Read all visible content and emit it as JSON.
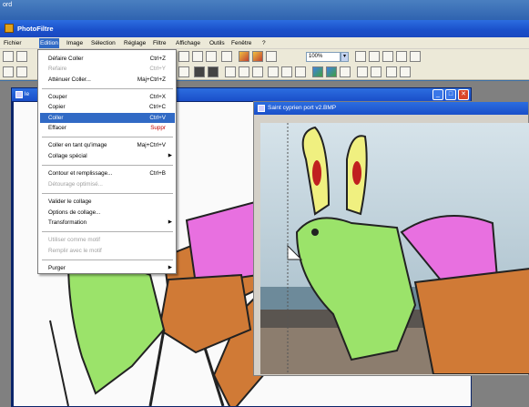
{
  "desktop": {
    "label": "ord"
  },
  "app": {
    "title": "PhotoFiltre"
  },
  "menubar": [
    {
      "label": "Fichier",
      "active": false
    },
    {
      "label": "Edition",
      "active": true
    },
    {
      "label": "Image",
      "active": false
    },
    {
      "label": "Sélection",
      "active": false
    },
    {
      "label": "Réglage",
      "active": false
    },
    {
      "label": "Filtre",
      "active": false
    },
    {
      "label": "Affichage",
      "active": false
    },
    {
      "label": "Outils",
      "active": false
    },
    {
      "label": "Fenêtre",
      "active": false
    },
    {
      "label": "?",
      "active": false
    }
  ],
  "toolbar": {
    "zoom_value": "100%",
    "zoom_dropdown": "▾"
  },
  "window_controls": {
    "minimize": "_",
    "maximize": "□",
    "close": "✕"
  },
  "background_window": {
    "title": "le"
  },
  "image_window": {
    "title": "Saint cyprien port v2.BMP"
  },
  "edit_menu": [
    {
      "label": "Défaire Coller",
      "shortcut": "Ctrl+Z",
      "disabled": false
    },
    {
      "label": "Refaire",
      "shortcut": "Ctrl+Y",
      "disabled": true
    },
    {
      "label": "Atténuer Coller...",
      "shortcut": "Maj+Ctrl+Z",
      "disabled": false
    },
    {
      "sep": true
    },
    {
      "label": "Couper",
      "shortcut": "Ctrl+X",
      "disabled": false
    },
    {
      "label": "Copier",
      "shortcut": "Ctrl+C",
      "disabled": false
    },
    {
      "label": "Coller",
      "shortcut": "Ctrl+V",
      "disabled": false,
      "highlighted": true
    },
    {
      "label": "Effacer",
      "shortcut": "Suppr",
      "disabled": false,
      "red": true
    },
    {
      "sep": true
    },
    {
      "label": "Coller en tant qu'image",
      "shortcut": "Maj+Ctrl+V",
      "disabled": false
    },
    {
      "label": "Collage spécial",
      "shortcut": "",
      "submenu": true,
      "disabled": false
    },
    {
      "sep": true
    },
    {
      "label": "Contour et remplissage...",
      "shortcut": "Ctrl+B",
      "disabled": false
    },
    {
      "label": "Détourage optimisé...",
      "shortcut": "",
      "disabled": true
    },
    {
      "sep": true
    },
    {
      "label": "Valider le collage",
      "shortcut": "",
      "disabled": false
    },
    {
      "label": "Options de collage...",
      "shortcut": "",
      "disabled": false
    },
    {
      "label": "Transformation",
      "shortcut": "",
      "submenu": true,
      "disabled": false
    },
    {
      "sep": true
    },
    {
      "label": "Utiliser comme motif",
      "shortcut": "",
      "disabled": true
    },
    {
      "label": "Remplir avec le motif",
      "shortcut": "",
      "disabled": true
    },
    {
      "sep": true
    },
    {
      "label": "Purger",
      "shortcut": "",
      "submenu": true,
      "disabled": false
    }
  ],
  "colors": {
    "titlebar": "#1a4fc9",
    "menu_highlight": "#316ac5",
    "drawing_green": "#9be36a",
    "drawing_orange": "#d07a36",
    "drawing_pink": "#e870e0",
    "drawing_yellow": "#f0f080"
  }
}
